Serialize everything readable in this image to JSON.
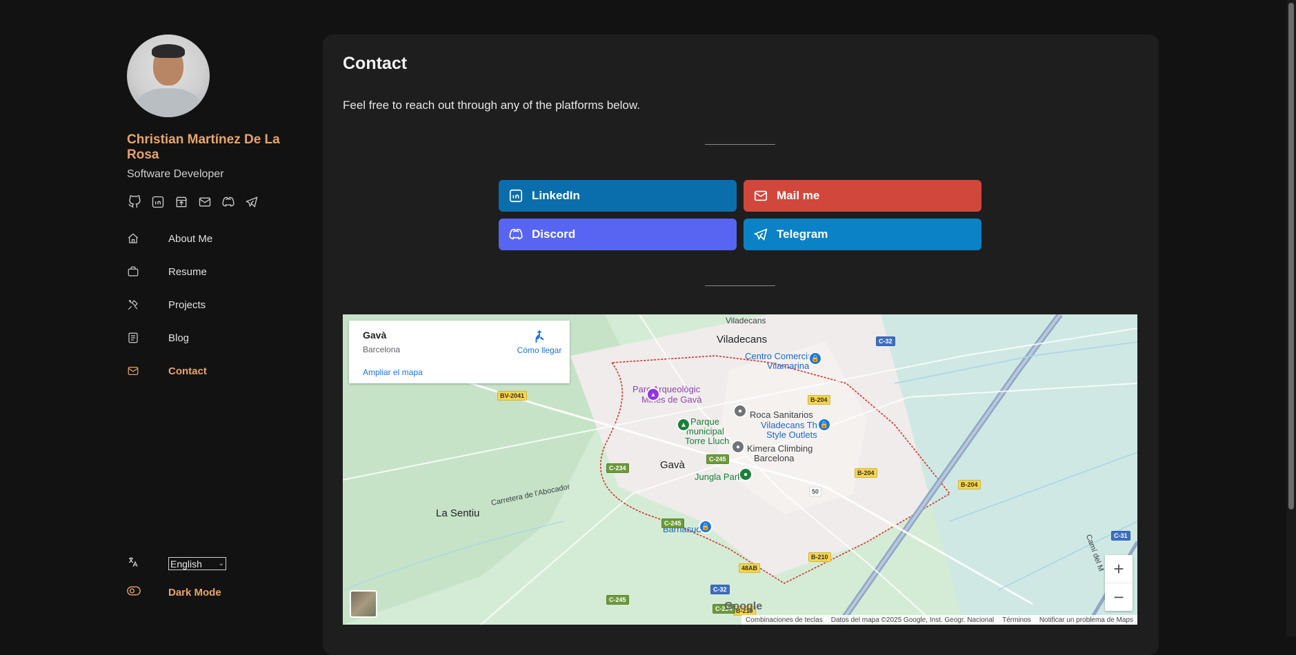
{
  "profile": {
    "name": "Christian Martínez De La Rosa",
    "role": "Software Developer",
    "socials": [
      "github-icon",
      "linkedin-icon",
      "store-icon",
      "mail-icon",
      "discord-icon",
      "telegram-icon"
    ]
  },
  "nav": {
    "items": [
      {
        "label": "About Me",
        "icon": "home-icon"
      },
      {
        "label": "Resume",
        "icon": "briefcase-icon"
      },
      {
        "label": "Projects",
        "icon": "tools-icon"
      },
      {
        "label": "Blog",
        "icon": "document-icon"
      },
      {
        "label": "Contact",
        "icon": "mail-icon",
        "active": true
      }
    ]
  },
  "settings": {
    "language_value": "English",
    "dark_mode_label": "Dark Mode"
  },
  "contact": {
    "title": "Contact",
    "intro": "Feel free to reach out through any of the platforms below.",
    "buttons": {
      "linkedin": "LinkedIn",
      "mail": "Mail me",
      "discord": "Discord",
      "telegram": "Telegram"
    }
  },
  "colors": {
    "accent": "#e8a567",
    "linkedin": "#0a6ead",
    "mail": "#d2473b",
    "discord": "#5865f2",
    "telegram": "#0b82c6"
  },
  "map": {
    "place": "Gavà",
    "region": "Barcelona",
    "directions": "Cómo llegar",
    "enlarge": "Ampliar el mapa",
    "labels": {
      "viladecans": "Viladecans",
      "viladecans_top": "Viladecans",
      "centro_comercial": "Centro Comercial",
      "vilamarina": "Vilamarina",
      "parc_arqueologic": "Parc Arqueològic",
      "mines": "Mines de Gavà",
      "parque": "Parque",
      "municipal": "municipal",
      "torre_lluch": "Torre Lluch",
      "roca": "Roca Sanitarios",
      "viladecans_the": "Viladecans The",
      "style_outlets": "Style Outlets",
      "kimera": "Kimera Climbing",
      "barcelona": "Barcelona",
      "gava": "Gavà",
      "jungla": "Jungla Park",
      "la_sentiu": "La Sentiu",
      "carretera": "Carretera de l'Abocador",
      "barnasud": "Barnasud",
      "cami": "Camí del M"
    },
    "roads": {
      "bv2041": "BV-2041",
      "c234": "C-234",
      "c245a": "C-245",
      "c245b": "C-245",
      "c245c": "C-245",
      "c32a": "C-32",
      "c32b": "C-32",
      "c31": "C-31",
      "b204a": "B-204",
      "b204b": "B-204",
      "b204c": "B-204",
      "b210a": "B-210",
      "b210b": "B-210",
      "r48ab": "48AB",
      "c234b": "C-234",
      "r50": "50"
    },
    "google": "Google",
    "attribution": {
      "shortcuts": "Combinaciones de teclas",
      "data": "Datos del mapa ©2025 Google, Inst. Geogr. Nacional",
      "terms": "Términos",
      "report": "Notificar un problema de Maps"
    },
    "zoom_in": "+",
    "zoom_out": "−"
  }
}
